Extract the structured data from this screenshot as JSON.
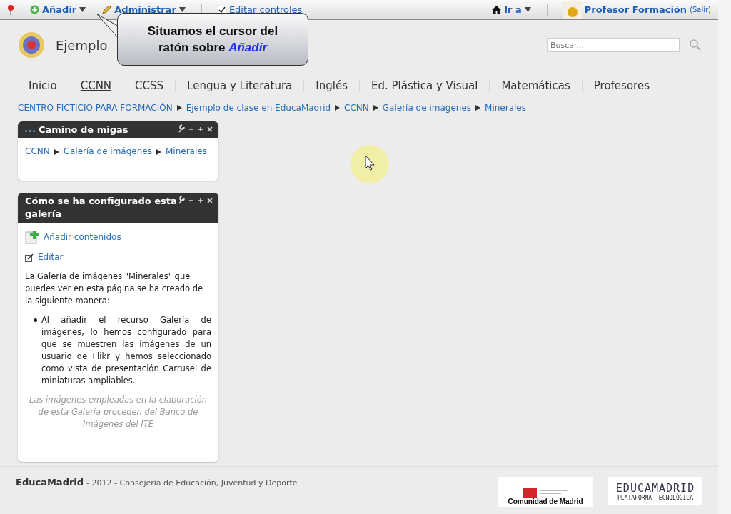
{
  "top_bar": {
    "left": [
      {
        "kind": "add",
        "label": "Añadir"
      },
      {
        "kind": "manage",
        "label": "Administrar"
      },
      {
        "kind": "check",
        "label": "Editar controles",
        "checked": true
      }
    ],
    "goto": "Ir a",
    "user": "Profesor Formación",
    "logout": "(Salir)"
  },
  "callout": {
    "line1": "Situamos el cursor del",
    "line2_prefix": "ratón sobre",
    "line2_highlight": "Añadir"
  },
  "header": {
    "site_title": "Ejemplo",
    "search": {
      "placeholder": "Buscar..."
    }
  },
  "nav": [
    {
      "label": "Inicio",
      "selected": false
    },
    {
      "label": "CCNN",
      "selected": true
    },
    {
      "label": "CCSS",
      "selected": false
    },
    {
      "label": "Lengua y Literatura",
      "selected": false
    },
    {
      "label": "Inglés",
      "selected": false
    },
    {
      "label": "Ed. Plástica y Visual",
      "selected": false
    },
    {
      "label": "Matemáticas",
      "selected": false
    },
    {
      "label": "Profesores",
      "selected": false
    }
  ],
  "breadcrumb": [
    "CENTRO FICTICIO PARA FORMACIÓN",
    "Ejemplo de clase en EducaMadrid",
    "CCNN",
    "Galería de imágenes",
    "Minerales"
  ],
  "panels": [
    {
      "kind": "crumbs",
      "title": "Camino de migas",
      "links": [
        "CCNN",
        "Galería de imágenes",
        "Minerales"
      ]
    },
    {
      "kind": "content",
      "title": "Cómo se ha configurado esta galería",
      "add_link": "Añadir contenidos",
      "edit_link": "Editar",
      "intro": "La Galería de imágenes \"Minerales\" que puedes ver en esta página se ha creado de la siguiente manera:",
      "bullets": [
        "Al añadir el recurso Galería de imágenes, lo hemos configurado para que se muestren las imágenes de un usuario de Flikr y hemos seleccionado como vista de presentación Carrusel de miniaturas ampliables."
      ],
      "note": "Las imágenes empleadas en la elaboración de esta Galería proceden del Banco de Imágenes del ITE"
    }
  ],
  "footer": {
    "brand": "EducaMadrid",
    "text": "- 2012 - Consejería de Educación, Juventud y Deporte",
    "logo_cm": "Comunidad de Madrid",
    "logo_em": "EDUCAMADRID",
    "logo_em_sub": "PLATAFORMA TECNOLÓGICA"
  }
}
